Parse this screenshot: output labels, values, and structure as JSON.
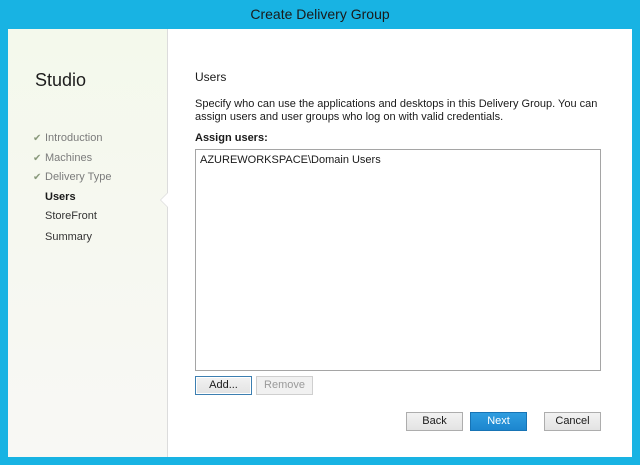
{
  "window": {
    "title": "Create Delivery Group"
  },
  "sidebar": {
    "heading": "Studio",
    "steps": [
      {
        "label": "Introduction",
        "state": "done"
      },
      {
        "label": "Machines",
        "state": "done"
      },
      {
        "label": "Delivery Type",
        "state": "done"
      },
      {
        "label": "Users",
        "state": "current"
      },
      {
        "label": "StoreFront",
        "state": "todo"
      },
      {
        "label": "Summary",
        "state": "todo"
      }
    ],
    "check_glyph": "✔"
  },
  "main": {
    "title": "Users",
    "description": "Specify who can use the applications and desktops in this Delivery Group. You can assign users and user groups who log on with valid credentials.",
    "assign_label": "Assign users:",
    "users": [
      "AZUREWORKSPACE\\Domain Users"
    ]
  },
  "buttons": {
    "add": "Add...",
    "remove": "Remove",
    "back": "Back",
    "next": "Next",
    "cancel": "Cancel"
  },
  "colors": {
    "title_bar": "#18b3e3",
    "primary_button": "#1c86cf"
  }
}
